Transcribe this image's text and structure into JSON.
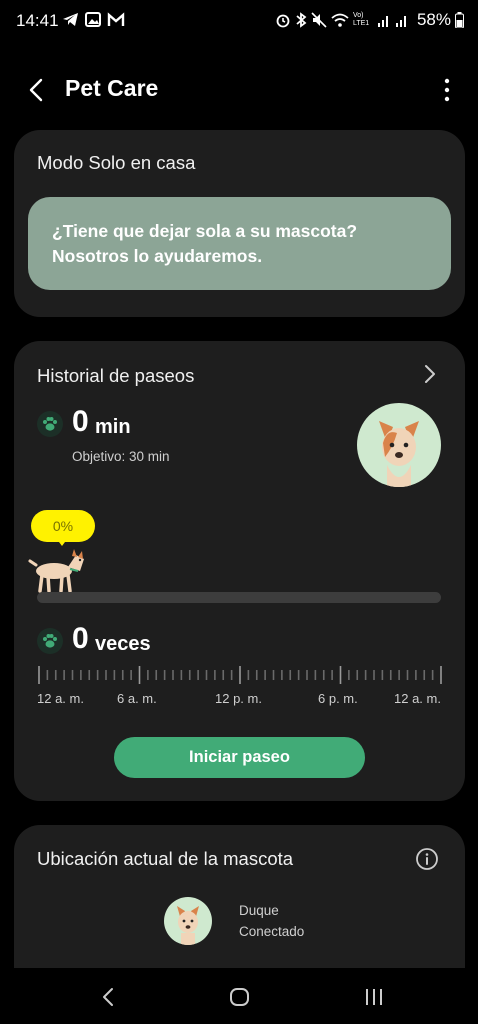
{
  "status_bar": {
    "time": "14:41",
    "battery": "58%",
    "network_label": "Vo) LTE1"
  },
  "header": {
    "title": "Pet Care"
  },
  "solo_card": {
    "title": "Modo Solo en casa",
    "banner_text": "¿Tiene que dejar sola a su mascota?\nNosotros lo ayudaremos.",
    "banner_color": "#8ca596"
  },
  "walk_card": {
    "title": "Historial de paseos",
    "minutes_value": "0",
    "minutes_unit": "min",
    "goal": "Objetivo: 30 min",
    "progress_label": "0%",
    "progress_fraction": 0,
    "count_value": "0",
    "count_unit": "veces",
    "time_labels": [
      "12 a. m.",
      "6 a. m.",
      "12 p. m.",
      "6 p. m.",
      "12 a. m."
    ],
    "start_button": "Iniciar paseo",
    "accent_color": "#41ab77"
  },
  "location_card": {
    "title": "Ubicación actual de la mascota",
    "pet_name": "Duque",
    "pet_status": "Conectado"
  }
}
